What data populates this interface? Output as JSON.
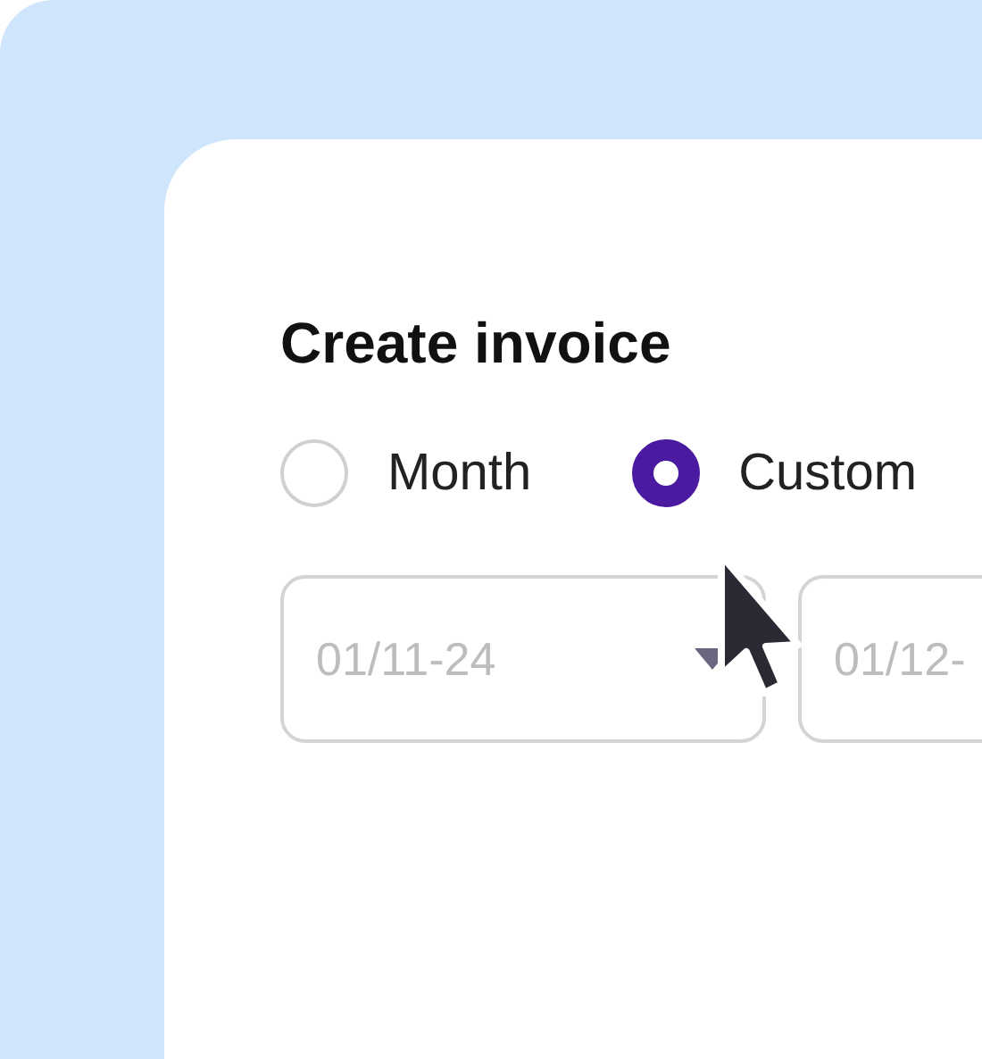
{
  "title": "Create invoice",
  "period_options": [
    {
      "label": "Month",
      "selected": false
    },
    {
      "label": "Custom",
      "selected": true
    }
  ],
  "date_fields": [
    {
      "placeholder": "01/11-24",
      "kind": "dropdown"
    },
    {
      "placeholder": "01/12-",
      "kind": "plain"
    }
  ]
}
